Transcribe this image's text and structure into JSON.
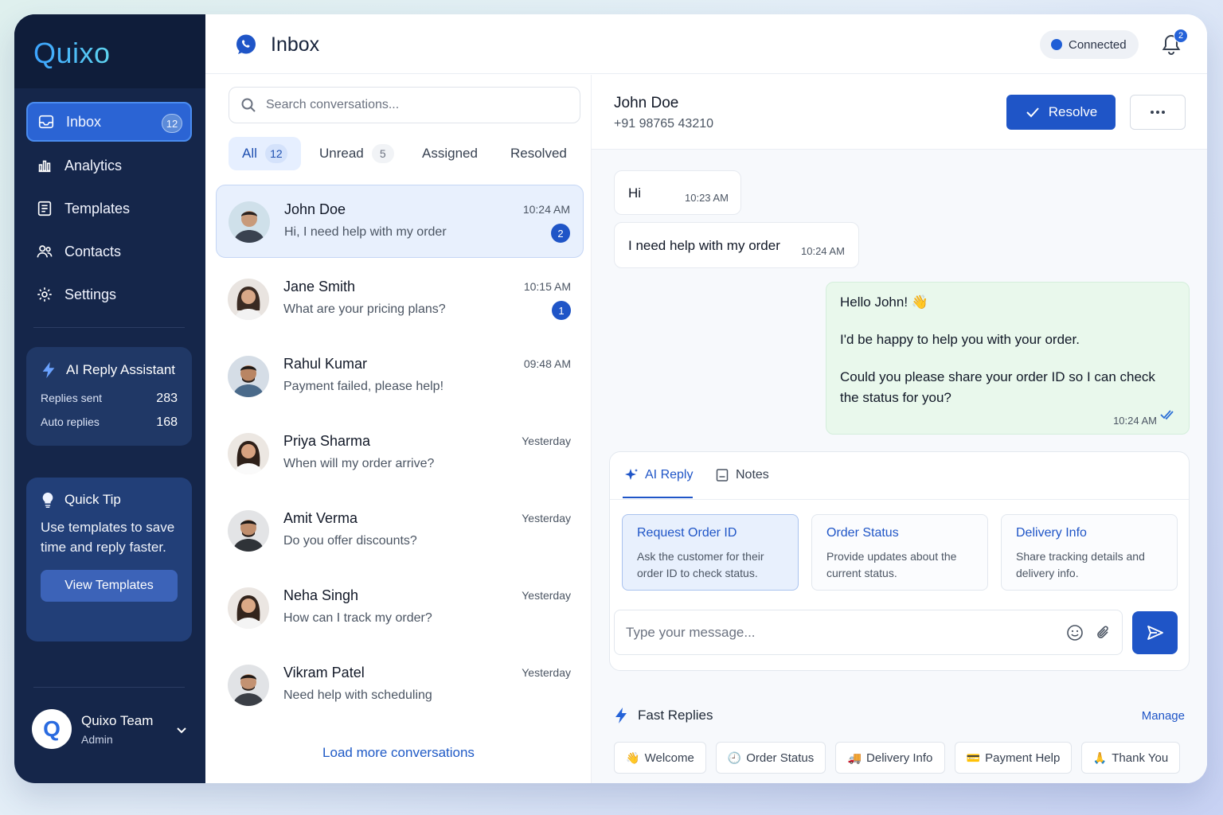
{
  "brand": "Quixo",
  "sidebar": {
    "items": [
      {
        "label": "Inbox",
        "badge": "12"
      },
      {
        "label": "Analytics"
      },
      {
        "label": "Templates"
      },
      {
        "label": "Contacts"
      },
      {
        "label": "Settings"
      }
    ],
    "ai": {
      "title": "AI Reply Assistant",
      "stats": [
        {
          "label": "Replies sent",
          "value": "283"
        },
        {
          "label": "Auto replies",
          "value": "168"
        }
      ]
    },
    "tip": {
      "title": "Quick Tip",
      "text": "Use templates to save time and reply faster.",
      "button": "View Templates"
    },
    "user": {
      "initial": "Q",
      "name": "Quixo Team",
      "role": "Admin"
    }
  },
  "header": {
    "title": "Inbox",
    "status": "Connected",
    "notifications": "2"
  },
  "list": {
    "search_placeholder": "Search conversations...",
    "tabs": [
      {
        "label": "All",
        "count": "12"
      },
      {
        "label": "Unread",
        "count": "5"
      },
      {
        "label": "Assigned"
      },
      {
        "label": "Resolved"
      }
    ],
    "conversations": [
      {
        "name": "John Doe",
        "preview": "Hi, I need help with my order",
        "time": "10:24 AM",
        "badge": "2"
      },
      {
        "name": "Jane Smith",
        "preview": "What are your pricing plans?",
        "time": "10:15 AM",
        "badge": "1"
      },
      {
        "name": "Rahul Kumar",
        "preview": "Payment failed, please help!",
        "time": "09:48 AM"
      },
      {
        "name": "Priya Sharma",
        "preview": "When will my order arrive?",
        "time": "Yesterday"
      },
      {
        "name": "Amit Verma",
        "preview": "Do you offer discounts?",
        "time": "Yesterday"
      },
      {
        "name": "Neha Singh",
        "preview": "How can I track my order?",
        "time": "Yesterday"
      },
      {
        "name": "Vikram Patel",
        "preview": "Need help with scheduling",
        "time": "Yesterday"
      }
    ],
    "load_more": "Load more conversations"
  },
  "chat": {
    "contact_name": "John Doe",
    "contact_phone": "+91 98765 43210",
    "resolve_label": "Resolve",
    "messages": [
      {
        "text": "Hi",
        "time": "10:23 AM"
      },
      {
        "text": "I need help with my order",
        "time": "10:24 AM"
      },
      {
        "lines": [
          "Hello John! 👋",
          "I'd be happy to help you with your order.",
          "Could you please share your order ID so I can check the status for you?"
        ],
        "time": "10:24 AM"
      }
    ],
    "reply_tabs": [
      "AI Reply",
      "Notes"
    ],
    "suggestions": [
      {
        "title": "Request Order ID",
        "desc": "Ask the customer for their order ID to check status."
      },
      {
        "title": "Order Status",
        "desc": "Provide updates about the current status."
      },
      {
        "title": "Delivery Info",
        "desc": "Share tracking details and delivery info."
      }
    ],
    "input_placeholder": "Type your message...",
    "fast_replies_title": "Fast Replies",
    "manage_label": "Manage",
    "fast_replies": [
      {
        "emoji": "👋",
        "label": "Welcome"
      },
      {
        "emoji": "🕘",
        "label": "Order Status"
      },
      {
        "emoji": "🚚",
        "label": "Delivery Info"
      },
      {
        "emoji": "💳",
        "label": "Payment Help"
      },
      {
        "emoji": "🙏",
        "label": "Thank You"
      }
    ]
  },
  "colors": {
    "primary": "#1f55c7",
    "sidebar": "#15264a",
    "outgoing_bubble": "#e9f8ec"
  }
}
